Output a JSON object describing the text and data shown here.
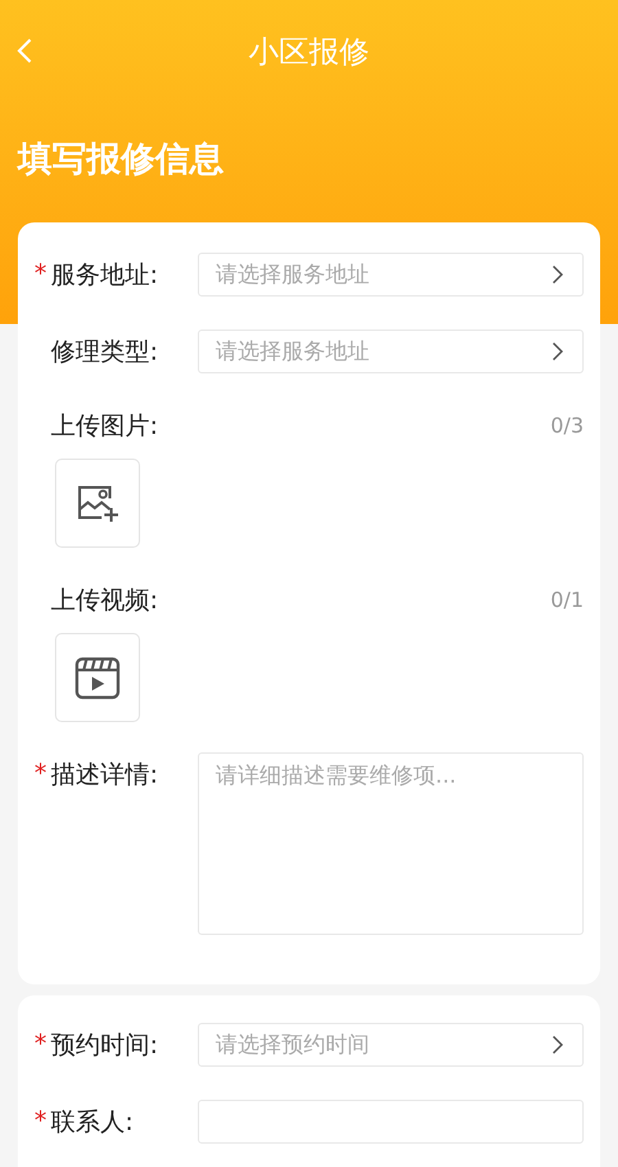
{
  "header": {
    "title": "小区报修",
    "heading": "填写报修信息"
  },
  "cards": [
    {
      "fields": [
        {
          "kind": "select",
          "mark": "*",
          "label": "服务地址:",
          "placeholder": "请选择服务地址"
        },
        {
          "kind": "select",
          "label": "修理类型:",
          "placeholder": "请选择服务地址"
        },
        {
          "kind": "image_upload",
          "label": "上传图片:",
          "count": "0/3"
        },
        {
          "kind": "video_upload",
          "label": "上传视频:",
          "count": "0/1"
        },
        {
          "kind": "textarea",
          "mark": "*",
          "label": "描述详情:",
          "placeholder": "请详细描述需要维修项..."
        }
      ]
    },
    {
      "fields": [
        {
          "kind": "select",
          "mark": "*",
          "label": "预约时间:",
          "placeholder": "请选择预约时间"
        },
        {
          "kind": "input",
          "mark": "*",
          "label": "联系人:"
        }
      ]
    }
  ]
}
